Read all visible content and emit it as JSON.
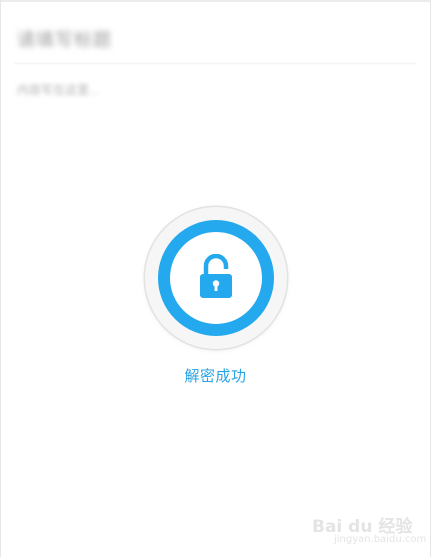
{
  "note": {
    "title_placeholder": "请填写标题",
    "content_placeholder": "内容写在这里..."
  },
  "unlock": {
    "status_text": "解密成功",
    "icon": "unlocked-padlock-icon",
    "accent_color": "#25a9ee",
    "text_color": "#27a4e6"
  },
  "watermark": {
    "text": "Bai du 经验",
    "subtext": "jingyan.baidu.com"
  }
}
